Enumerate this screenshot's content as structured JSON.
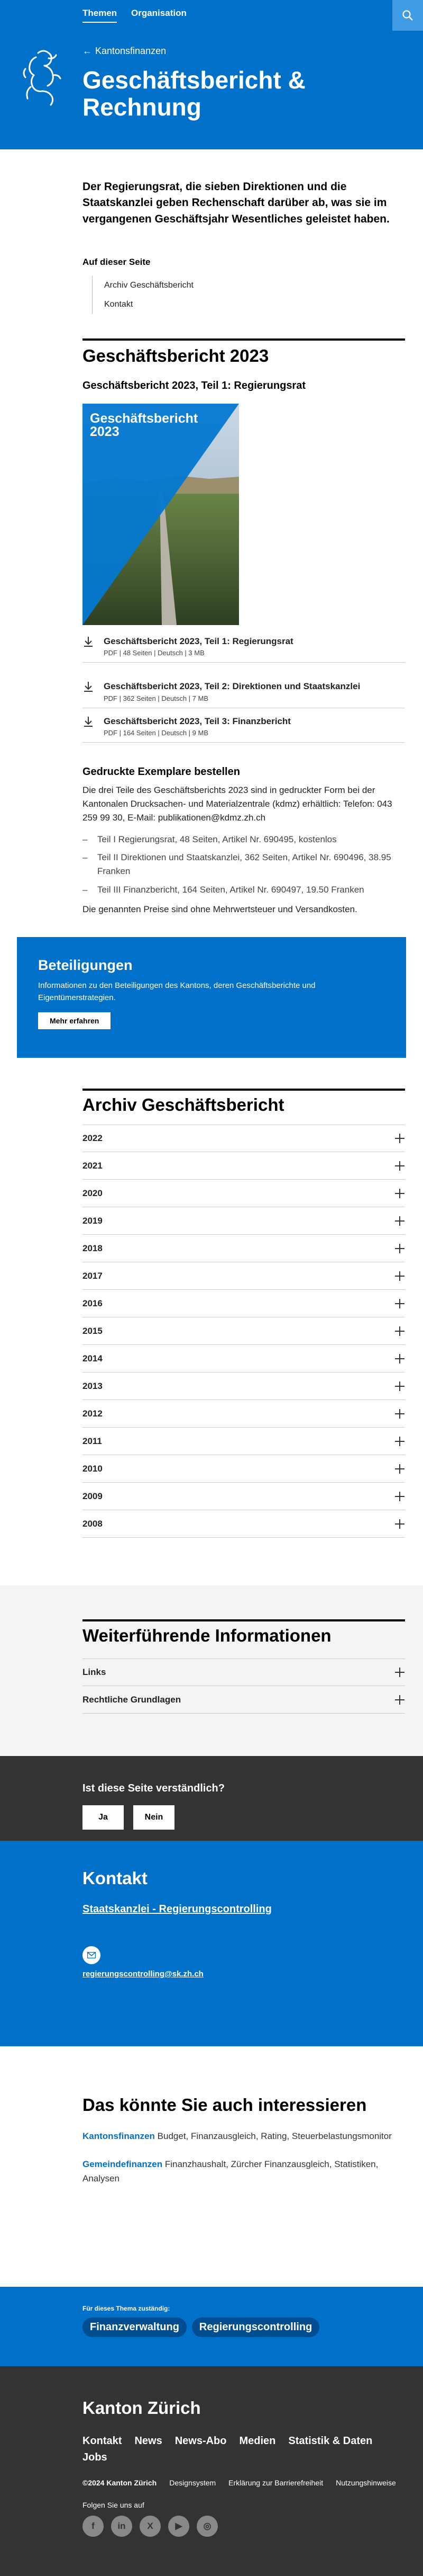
{
  "nav": {
    "items": [
      "Themen",
      "Organisation"
    ]
  },
  "hero": {
    "breadcrumb": "Kantonsfinanzen",
    "title": "Geschäftsbericht & Rechnung"
  },
  "lead": "Der Regierungsrat, die sieben Direktionen und die Staatskanzlei geben Rechenschaft darüber ab, was sie im vergangenen Geschäftsjahr Wesentliches geleistet haben.",
  "toc": {
    "title": "Auf dieser Seite",
    "items": [
      "Archiv Geschäftsbericht",
      "Kontakt"
    ]
  },
  "report": {
    "title": "Geschäftsbericht 2023",
    "subtitle": "Geschäftsbericht 2023, Teil 1: Regierungsrat",
    "cover_title_line1": "Geschäftsbericht",
    "cover_title_line2": "2023",
    "downloads": [
      {
        "title": "Geschäftsbericht 2023, Teil 1: Regierungsrat",
        "meta": "PDF | 48 Seiten | Deutsch | 3 MB"
      },
      {
        "title": "Geschäftsbericht 2023, Teil 2: Direktionen und Staatskanzlei",
        "meta": "PDF | 362 Seiten | Deutsch | 7 MB"
      },
      {
        "title": "Geschäftsbericht 2023, Teil 3: Finanzbericht",
        "meta": "PDF | 164 Seiten | Deutsch | 9 MB"
      }
    ],
    "order_title": "Gedruckte Exemplare bestellen",
    "order_text": "Die drei Teile des Geschäftsberichts 2023 sind in gedruckter Form bei der Kantonalen Drucksachen- und Materialzentrale (kdmz) erhältlich: Telefon: 043 259 99 30, E-Mail: publikationen@kdmz.zh.ch",
    "order_items": [
      "Teil I Regierungsrat, 48 Seiten, Artikel Nr. 690495, kostenlos",
      "Teil II Direktionen und Staatskanzlei, 362 Seiten, Artikel Nr. 690496, 38.95 Franken",
      "Teil III Finanzbericht, 164 Seiten, Artikel Nr. 690497, 19.50 Franken"
    ],
    "order_note": "Die genannten Preise sind ohne Mehrwertsteuer und Versandkosten."
  },
  "teaser": {
    "title": "Beteiligungen",
    "text": "Informationen zu den Beteiligungen des Kantons, deren Geschäftsberichte und Eigentümerstrategien.",
    "button": "Mehr erfahren"
  },
  "archive": {
    "title": "Archiv Geschäftsbericht",
    "years": [
      "2022",
      "2021",
      "2020",
      "2019",
      "2018",
      "2017",
      "2016",
      "2015",
      "2014",
      "2013",
      "2012",
      "2011",
      "2010",
      "2009",
      "2008"
    ]
  },
  "further": {
    "title": "Weiterführende Informationen",
    "items": [
      "Links",
      "Rechtliche Grundlagen"
    ]
  },
  "feedback": {
    "question": "Ist diese Seite verständlich?",
    "yes": "Ja",
    "no": "Nein"
  },
  "contact": {
    "title": "Kontakt",
    "org": "Staatskanzlei - Regierungscontrolling",
    "email": "regierungscontrolling@sk.zh.ch"
  },
  "interest": {
    "title": "Das könnte Sie auch interessieren",
    "items": [
      {
        "link": "Kantonsfinanzen",
        "text": " Budget, Finanzausgleich, Rating, Steuerbelastungsmonitor"
      },
      {
        "link": "Gemeindefinanzen",
        "text": " Finanzhaushalt, Zürcher Finanzausgleich, Statistiken, Analysen"
      }
    ]
  },
  "topics": {
    "label": "Für dieses Thema zuständig:",
    "tags": [
      "Finanzverwaltung",
      "Regierungscontrolling"
    ]
  },
  "footer": {
    "brand": "Kanton Zürich",
    "nav": [
      "Kontakt",
      "News",
      "News-Abo",
      "Medien",
      "Statistik & Daten",
      "Jobs"
    ],
    "copyright": "©2024 Kanton Zürich",
    "legal": [
      "Designsystem",
      "Erklärung zur Barrierefreiheit",
      "Nutzungshinweise"
    ],
    "follow": "Folgen Sie uns auf",
    "socials": [
      "f",
      "in",
      "X",
      "▶",
      "◎"
    ]
  },
  "colors": {
    "brand_blue": "#0070c9",
    "dark": "#333333"
  }
}
